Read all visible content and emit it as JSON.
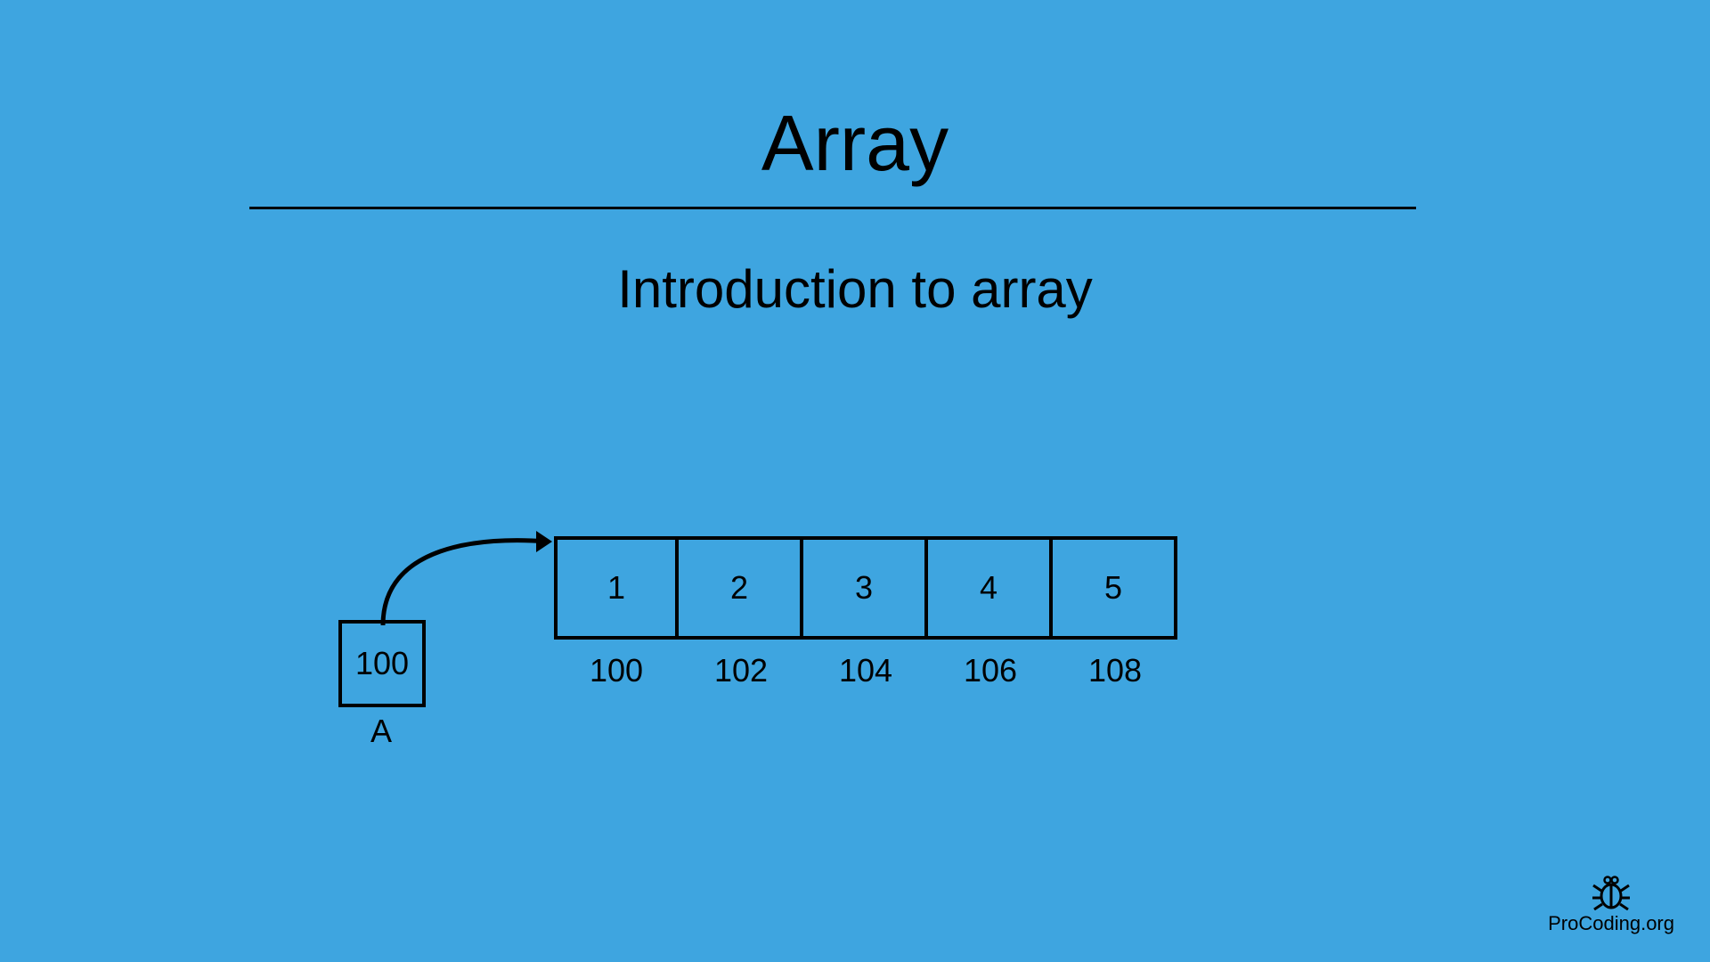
{
  "title": "Array",
  "subtitle": "Introduction to array",
  "pointer": {
    "value": "100",
    "label": "A"
  },
  "array": {
    "cells": [
      "1",
      "2",
      "3",
      "4",
      "5"
    ],
    "addresses": [
      "100",
      "102",
      "104",
      "106",
      "108"
    ]
  },
  "watermark": "ProCoding.org"
}
